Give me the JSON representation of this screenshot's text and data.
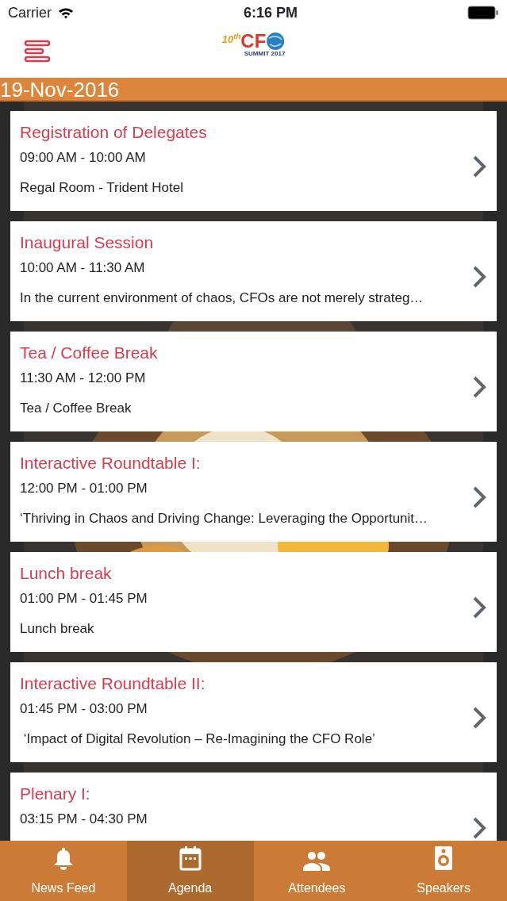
{
  "status_bar": {
    "carrier": "Carrier",
    "time": "6:16 PM"
  },
  "header": {
    "logo": {
      "edition": "10$^{th}$",
      "mark": "CF",
      "subtitle": "SUMMIT 2017"
    }
  },
  "date": "19-Nov-2016",
  "sessions": [
    {
      "title": "Registration of Delegates",
      "time": "09:00 AM - 10:00 AM",
      "description": "Regal Room - Trident Hotel"
    },
    {
      "title": "Inaugural Session",
      "time": "10:00 AM - 11:30 AM",
      "description": "In the current environment of chaos, CFOs are not merely strateg…"
    },
    {
      "title": "Tea / Coffee Break",
      "time": "11:30 AM - 12:00 PM",
      "description": "Tea / Coffee Break"
    },
    {
      "title": "Interactive Roundtable I:",
      "time": "12:00 PM - 01:00 PM",
      "description": "‘Thriving in Chaos and Driving Change: Leveraging the Opportunit…"
    },
    {
      "title": "Lunch break",
      "time": "01:00 PM - 01:45 PM",
      "description": "Lunch break"
    },
    {
      "title": "Interactive Roundtable II:",
      "time": "01:45 PM - 03:00 PM",
      "description": " ‘Impact of Digital Revolution – Re-Imagining the CFO Role’"
    },
    {
      "title": "Plenary I:",
      "time": "03:15 PM - 04:30 PM"
    }
  ],
  "tabs": [
    {
      "kind": "bell",
      "label": "News Feed",
      "selected": false
    },
    {
      "kind": "calendar",
      "label": "Agenda",
      "selected": true
    },
    {
      "kind": "people",
      "label": "Attendees",
      "selected": false
    },
    {
      "kind": "speaker",
      "label": "Speakers",
      "selected": false
    }
  ]
}
